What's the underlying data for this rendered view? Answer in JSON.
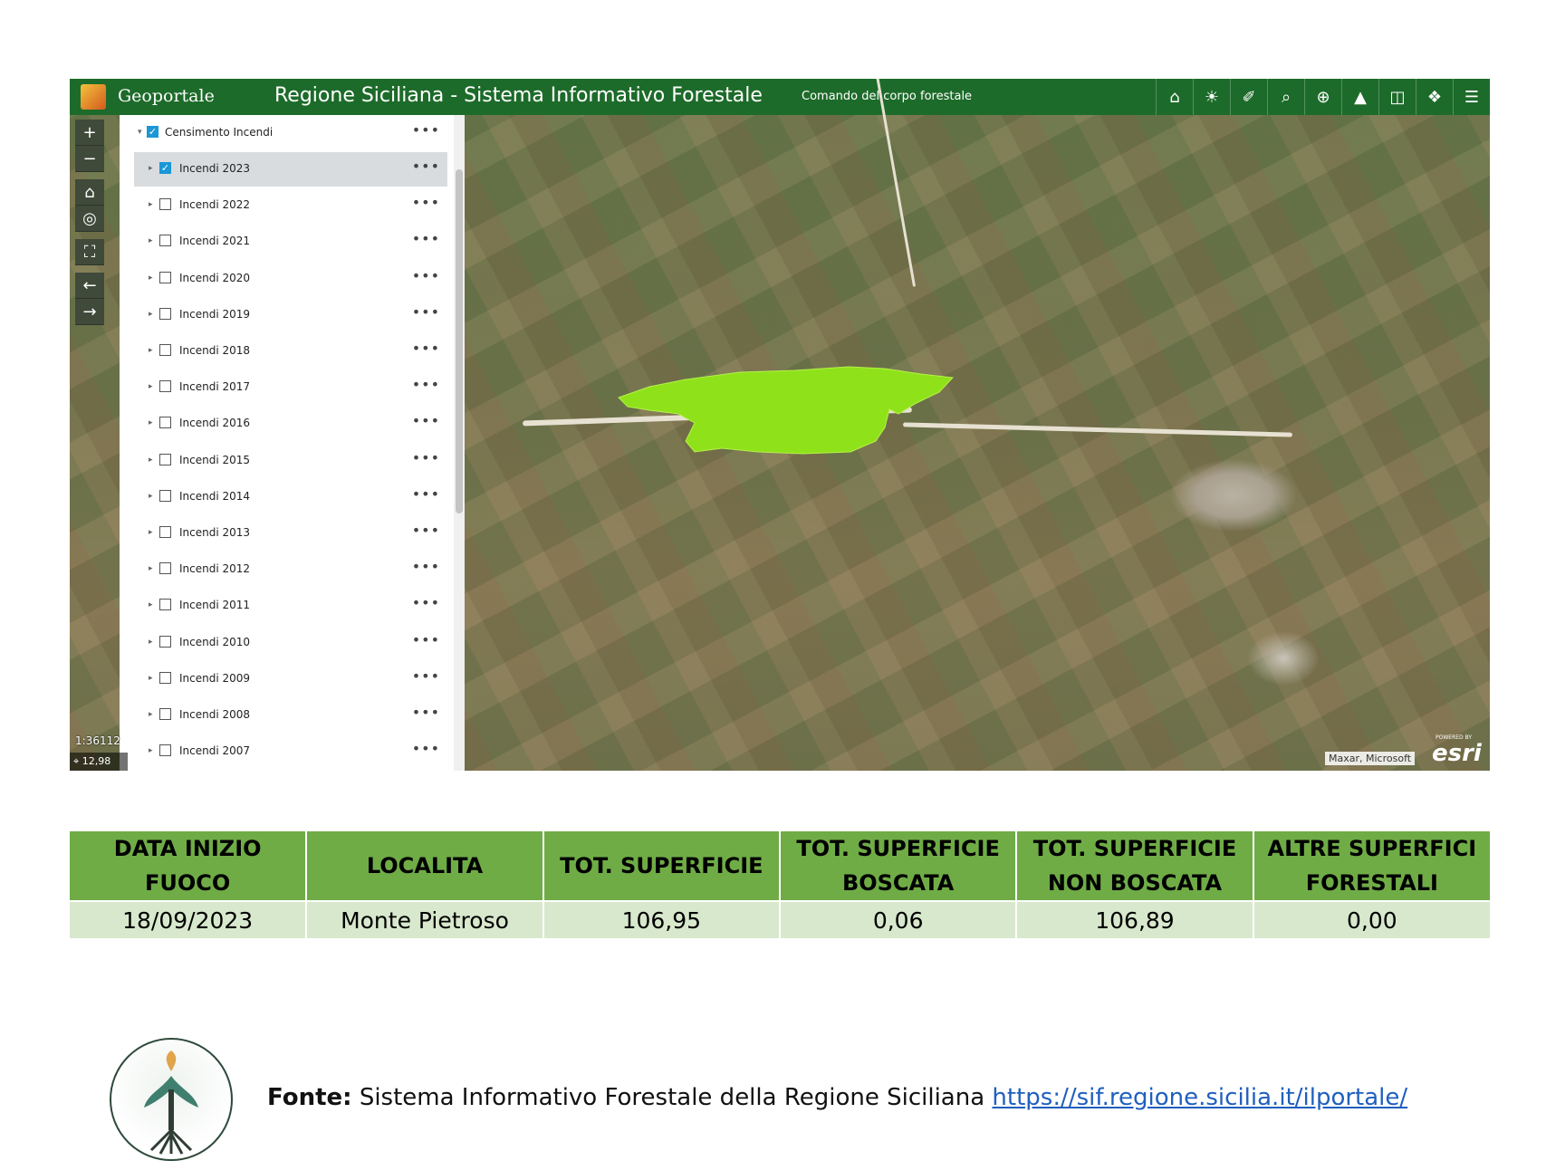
{
  "header": {
    "brand": "Geoportale",
    "title": "Regione Siciliana - Sistema Informativo Forestale",
    "subtitle": "Comando del corpo forestale",
    "tools": [
      "pin-icon",
      "sun-icon",
      "tag-icon",
      "search-map-icon",
      "target-icon",
      "cap-icon",
      "split-icon",
      "layers-icon",
      "menu-icon"
    ]
  },
  "map": {
    "scale": "1:36112",
    "coords": "12,98",
    "attribution": "Maxar, Microsoft",
    "esri_small": "POWERED BY",
    "esri_logo": "esri",
    "burn_color": "#8fe21a"
  },
  "layers": {
    "group": "Censimento Incendi",
    "items": [
      {
        "label": "Incendi 2023",
        "checked": true
      },
      {
        "label": "Incendi 2022",
        "checked": false
      },
      {
        "label": "Incendi 2021",
        "checked": false
      },
      {
        "label": "Incendi 2020",
        "checked": false
      },
      {
        "label": "Incendi 2019",
        "checked": false
      },
      {
        "label": "Incendi 2018",
        "checked": false
      },
      {
        "label": "Incendi 2017",
        "checked": false
      },
      {
        "label": "Incendi 2016",
        "checked": false
      },
      {
        "label": "Incendi 2015",
        "checked": false
      },
      {
        "label": "Incendi 2014",
        "checked": false
      },
      {
        "label": "Incendi 2013",
        "checked": false
      },
      {
        "label": "Incendi 2012",
        "checked": false
      },
      {
        "label": "Incendi 2011",
        "checked": false
      },
      {
        "label": "Incendi 2010",
        "checked": false
      },
      {
        "label": "Incendi 2009",
        "checked": false
      },
      {
        "label": "Incendi 2008",
        "checked": false
      },
      {
        "label": "Incendi 2007",
        "checked": false
      }
    ]
  },
  "table": {
    "headers": [
      [
        "DATA INIZIO",
        "FUOCO"
      ],
      [
        "LOCALITA"
      ],
      [
        "TOT. SUPERFICIE"
      ],
      [
        "TOT. SUPERFICIE",
        "BOSCATA"
      ],
      [
        "TOT. SUPERFICIE",
        "NON BOSCATA"
      ],
      [
        "ALTRE SUPERFICI",
        "FORESTALI"
      ]
    ],
    "row": [
      "18/09/2023",
      "Monte Pietroso",
      "106,95",
      "0,06",
      "106,89",
      "0,00"
    ]
  },
  "footer": {
    "label": "Fonte:",
    "text": "Sistema Informativo Forestale della Regione Siciliana",
    "link": "https://sif.regione.sicilia.it/ilportale/"
  }
}
